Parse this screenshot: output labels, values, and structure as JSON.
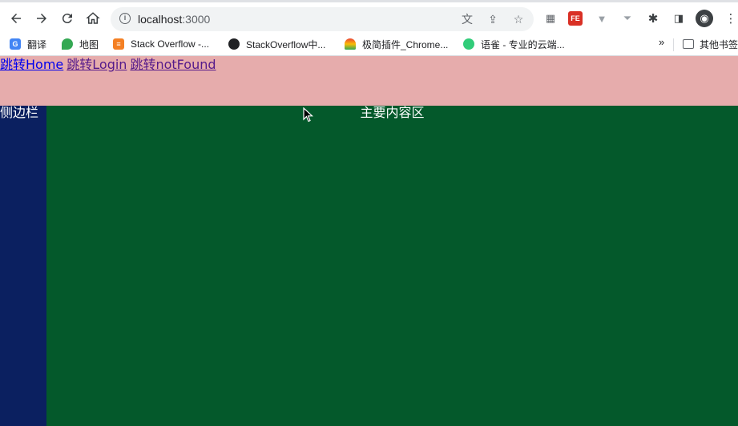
{
  "browser": {
    "url_host": "localhost",
    "url_port": ":3000",
    "bookmarks": [
      {
        "label": "翻译",
        "icon": "google-translate-icon",
        "color": "#4285f4"
      },
      {
        "label": "地图",
        "icon": "google-maps-icon",
        "color": "#34a853"
      },
      {
        "label": "Stack Overflow -...",
        "icon": "stackoverflow-icon",
        "color": "#f48024"
      },
      {
        "label": "StackOverflow中...",
        "icon": "globe-icon",
        "color": "#202124"
      },
      {
        "label": "极简插件_Chrome...",
        "icon": "rainbow-icon",
        "color": "#ea4335"
      },
      {
        "label": "语雀 - 专业的云端...",
        "icon": "yuque-icon",
        "color": "#31cc79"
      }
    ],
    "more_label": "»",
    "other_bookmarks": "其他书签"
  },
  "header": {
    "links": [
      "跳转Home",
      "跳转Login",
      "跳转notFound"
    ]
  },
  "sidebar": {
    "label": "侧边栏"
  },
  "main": {
    "label": "主要内容区"
  },
  "colors": {
    "header_bg": "#e6acac",
    "sidebar_bg": "#0b2060",
    "main_bg": "#04592b"
  }
}
